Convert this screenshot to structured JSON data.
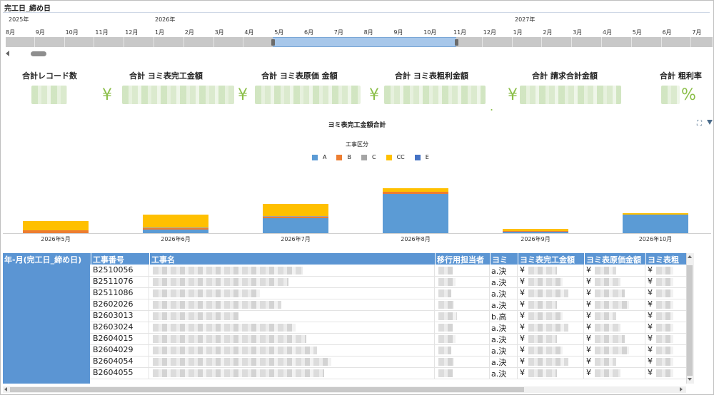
{
  "header": {
    "title": "完工日_締め日"
  },
  "timeline": {
    "years": [
      "2025年",
      "2026年",
      "2027年"
    ],
    "months": [
      "8月",
      "9月",
      "10月",
      "11月",
      "12月",
      "1月",
      "2月",
      "3月",
      "4月",
      "5月",
      "6月",
      "7月",
      "8月",
      "9月",
      "10月",
      "11月",
      "12月",
      "1月",
      "2月",
      "3月",
      "4月",
      "5月",
      "6月",
      "7月"
    ]
  },
  "kpis": [
    {
      "label": "合計レコード数",
      "prefix": ""
    },
    {
      "label": "合計 ヨミ表完工金額",
      "prefix": "¥"
    },
    {
      "label": "合計 ヨミ表原価 金額",
      "prefix": "¥"
    },
    {
      "label": "合計 ヨミ表粗利金額",
      "prefix": "¥"
    },
    {
      "label": "合計 請求合計金額",
      "prefix": "¥"
    },
    {
      "label": "合計 粗利率",
      "suffix": "%"
    }
  ],
  "chart_data": {
    "type": "bar",
    "title": "ヨミ表完工金額合計",
    "legend_title": "工事区分",
    "legend": "top-center",
    "categories": [
      "2026年5月",
      "2026年6月",
      "2026年7月",
      "2026年8月",
      "2026年9月",
      "2026年10月"
    ],
    "series": [
      {
        "name": "A",
        "color": "#5b9bd5",
        "values": [
          0,
          5,
          21,
          55,
          2,
          26
        ]
      },
      {
        "name": "B",
        "color": "#ed7d31",
        "values": [
          4,
          2,
          2,
          3,
          1,
          0
        ]
      },
      {
        "name": "C",
        "color": "#a5a5a5",
        "values": [
          0,
          1,
          1,
          0,
          0,
          0
        ]
      },
      {
        "name": "CC",
        "color": "#ffc000",
        "values": [
          13,
          18,
          17,
          5,
          3,
          2
        ]
      },
      {
        "name": "E",
        "color": "#4472c4",
        "values": [
          0,
          0,
          0,
          0,
          0,
          0
        ]
      }
    ]
  },
  "table": {
    "columns": [
      "年-月(完工日_締め日)",
      "工事番号",
      "工事名",
      "移行用担当者",
      "ヨミ",
      "ヨミ表完工金額",
      "ヨミ表原価金額",
      "ヨミ表粗"
    ],
    "rows": [
      {
        "no": "B2510056",
        "yomi": "a.決",
        "c1": "¥",
        "c2": "¥",
        "c3": "¥"
      },
      {
        "no": "B2511076",
        "yomi": "a.決",
        "c1": "¥",
        "c2": "¥",
        "c3": "¥"
      },
      {
        "no": "B2511086",
        "yomi": "a.決",
        "c1": "¥",
        "c2": "¥",
        "c3": "¥"
      },
      {
        "no": "B2602026",
        "yomi": "a.決",
        "c1": "¥",
        "c2": "¥",
        "c3": "¥"
      },
      {
        "no": "B2603013",
        "yomi": "b.高",
        "c1": "¥",
        "c2": "¥",
        "c3": "¥"
      },
      {
        "no": "B2603024",
        "yomi": "a.決",
        "c1": "¥",
        "c2": "¥",
        "c3": "¥"
      },
      {
        "no": "B2604015",
        "yomi": "a.決",
        "c1": "¥",
        "c2": "¥",
        "c3": "¥"
      },
      {
        "no": "B2604029",
        "yomi": "a.決",
        "c1": "¥",
        "c2": "¥",
        "c3": "¥"
      },
      {
        "no": "B2604054",
        "yomi": "a.決",
        "c1": "¥",
        "c2": "¥",
        "c3": "¥"
      },
      {
        "no": "B2604055",
        "yomi": "a.決",
        "c1": "¥",
        "c2": "¥",
        "c3": "¥"
      }
    ]
  },
  "icons": {
    "expand": "expand-icon",
    "filter": "filter-icon"
  }
}
